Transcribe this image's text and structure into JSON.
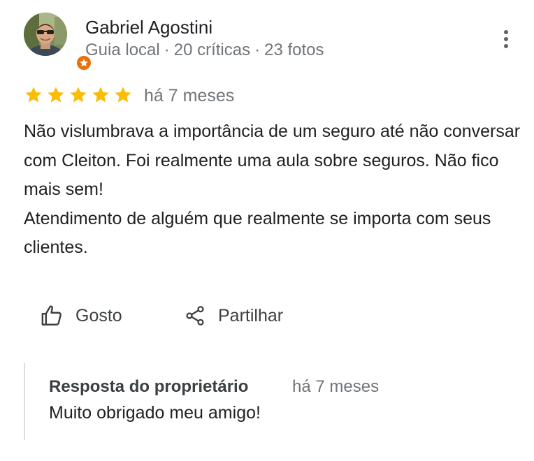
{
  "reviewer": {
    "name": "Gabriel Agostini",
    "badge": "Guia local",
    "separator": "·",
    "reviews_count": "20 críticas",
    "photos_count": "23 fotos"
  },
  "rating": {
    "stars": 5,
    "max_stars": 5,
    "date": "há 7 meses",
    "star_color": "#fbbc04"
  },
  "review": {
    "paragraphs": [
      "Não vislumbrava a importância de um seguro até não conversar com Cleiton. Foi realmente uma aula sobre seguros. Não fico mais sem!",
      "Atendimento de alguém que realmente se importa com seus clientes."
    ]
  },
  "actions": {
    "like_label": "Gosto",
    "share_label": "Partilhar"
  },
  "owner_response": {
    "title": "Resposta do proprietário",
    "date": "há 7 meses",
    "text": "Muito obrigado meu amigo!"
  },
  "icons": {
    "menu": "more-vert-icon",
    "like": "thumb-up-icon",
    "share": "share-icon",
    "badge": "local-guide-star-icon"
  },
  "colors": {
    "badge": "#e8710a",
    "secondary_text": "#70757a",
    "primary_text": "#202124"
  }
}
